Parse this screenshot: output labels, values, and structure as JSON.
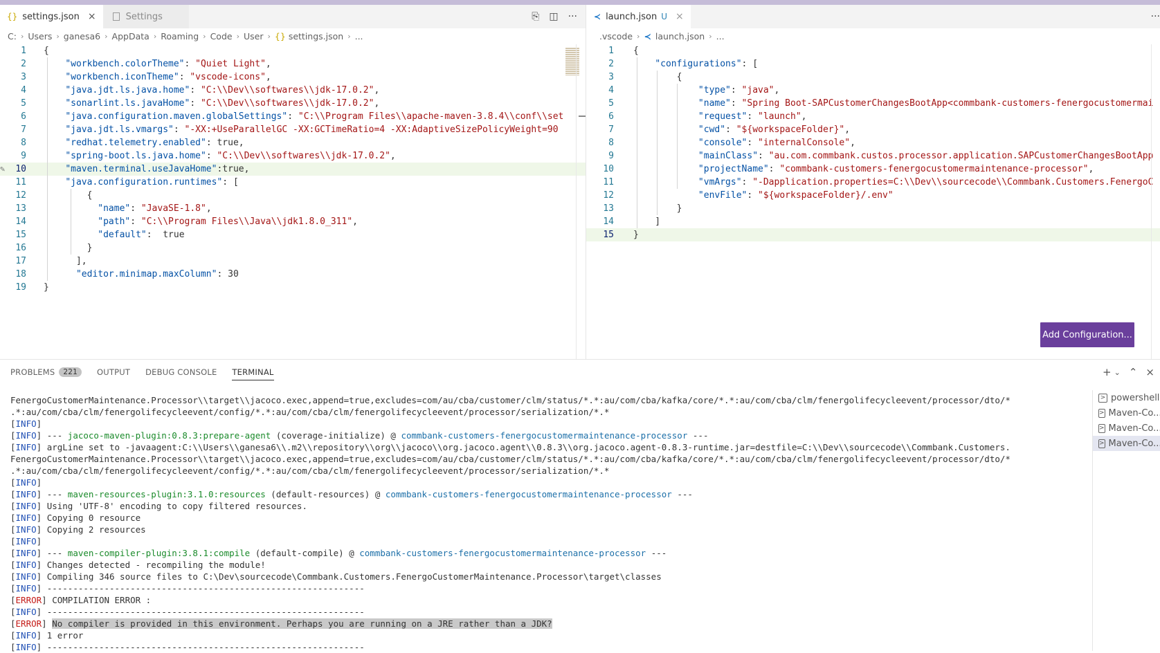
{
  "left_group": {
    "tabs": [
      {
        "icon": "{}",
        "label": "settings.json",
        "close": "×"
      },
      {
        "label": "Settings"
      }
    ],
    "breadcrumb": [
      "C:",
      "Users",
      "ganesa6",
      "AppData",
      "Roaming",
      "Code",
      "User",
      "settings.json",
      "..."
    ],
    "lines": [
      {
        "n": "1",
        "text": "{"
      },
      {
        "n": "2",
        "text": "    \"workbench.colorTheme\": \"Quiet Light\","
      },
      {
        "n": "3",
        "text": "    \"workbench.iconTheme\": \"vscode-icons\","
      },
      {
        "n": "4",
        "text": "    \"java.jdt.ls.java.home\": \"C:\\\\Dev\\\\softwares\\\\jdk-17.0.2\","
      },
      {
        "n": "5",
        "text": "    \"sonarlint.ls.javaHome\": \"C:\\\\Dev\\\\softwares\\\\jdk-17.0.2\","
      },
      {
        "n": "6",
        "text": "    \"java.configuration.maven.globalSettings\": \"C:\\\\Program Files\\\\apache-maven-3.8.4\\\\conf\\\\set"
      },
      {
        "n": "7",
        "text": "    \"java.jdt.ls.vmargs\": \"-XX:+UseParallelGC -XX:GCTimeRatio=4 -XX:AdaptiveSizePolicyWeight=90"
      },
      {
        "n": "8",
        "text": "    \"redhat.telemetry.enabled\": true,"
      },
      {
        "n": "9",
        "text": "    \"spring-boot.ls.java.home\": \"C:\\\\Dev\\\\softwares\\\\jdk-17.0.2\","
      },
      {
        "n": "10",
        "text": "    \"maven.terminal.useJavaHome\":true,"
      },
      {
        "n": "11",
        "text": "    \"java.configuration.runtimes\": ["
      },
      {
        "n": "12",
        "text": "        {"
      },
      {
        "n": "13",
        "text": "          \"name\": \"JavaSE-1.8\","
      },
      {
        "n": "14",
        "text": "          \"path\": \"C:\\\\Program Files\\\\Java\\\\jdk1.8.0_311\","
      },
      {
        "n": "15",
        "text": "          \"default\":  true"
      },
      {
        "n": "16",
        "text": "        }"
      },
      {
        "n": "17",
        "text": "      ],"
      },
      {
        "n": "18",
        "text": "      \"editor.minimap.maxColumn\": 30"
      },
      {
        "n": "19",
        "text": "}"
      }
    ],
    "actions": [
      "⎘",
      "◫",
      "···"
    ]
  },
  "right_group": {
    "tabs": [
      {
        "label": "launch.json",
        "badge": "U",
        "close": "×"
      }
    ],
    "breadcrumb": [
      ".vscode",
      "launch.json",
      "..."
    ],
    "lines": [
      {
        "n": "1",
        "text": "{"
      },
      {
        "n": "2",
        "text": "    \"configurations\": ["
      },
      {
        "n": "3",
        "text": "        {"
      },
      {
        "n": "4",
        "text": "            \"type\": \"java\","
      },
      {
        "n": "5",
        "text": "            \"name\": \"Spring Boot-SAPCustomerChangesBootApp<commbank-customers-fenergocustomermai"
      },
      {
        "n": "6",
        "text": "            \"request\": \"launch\","
      },
      {
        "n": "7",
        "text": "            \"cwd\": \"${workspaceFolder}\","
      },
      {
        "n": "8",
        "text": "            \"console\": \"internalConsole\","
      },
      {
        "n": "9",
        "text": "            \"mainClass\": \"au.com.commbank.custos.processor.application.SAPCustomerChangesBootApp"
      },
      {
        "n": "10",
        "text": "            \"projectName\": \"commbank-customers-fenergocustomermaintenance-processor\","
      },
      {
        "n": "11",
        "text": "            \"vmArgs\": \"-Dapplication.properties=C:\\\\Dev\\\\sourcecode\\\\Commbank.Customers.FenergoC"
      },
      {
        "n": "12",
        "text": "            \"envFile\": \"${workspaceFolder}/.env\""
      },
      {
        "n": "13",
        "text": "        }"
      },
      {
        "n": "14",
        "text": "    ]"
      },
      {
        "n": "15",
        "text": "}"
      }
    ],
    "add_configuration": "Add Configuration...",
    "more": "···"
  },
  "panel": {
    "tabs": [
      {
        "label": "PROBLEMS",
        "badge": "221"
      },
      {
        "label": "OUTPUT"
      },
      {
        "label": "DEBUG CONSOLE"
      },
      {
        "label": "TERMINAL"
      }
    ],
    "actions": [
      "+",
      "⌄",
      "⌃",
      "×"
    ],
    "terminal_lines": [
      [
        {
          "t": "FenergoCustomerMaintenance.Processor\\\\target\\\\jacoco.exec,append=true,excludes=com/au/cba/customer/clm/status/*.*:au/com/cba/kafka/core/*.*:au/com/cba/clm/fenergolifecycleevent/processor/dto/*"
        }
      ],
      [
        {
          "t": ".*:au/com/cba/clm/fenergolifecycleevent/config/*.*:au/com/cba/clm/fenergolifecycleevent/processor/serialization/*.*"
        }
      ],
      [
        {
          "t": "["
        },
        {
          "t": "INFO",
          "c": "info"
        },
        {
          "t": "]"
        }
      ],
      [
        {
          "t": "["
        },
        {
          "t": "INFO",
          "c": "info"
        },
        {
          "t": "] --- "
        },
        {
          "t": "jacoco-maven-plugin:0.8.3:prepare-agent",
          "c": "grn"
        },
        {
          "t": " (coverage-initialize) @ "
        },
        {
          "t": "commbank-customers-fenergocustomermaintenance-processor",
          "c": "cyn"
        },
        {
          "t": " ---"
        }
      ],
      [
        {
          "t": "["
        },
        {
          "t": "INFO",
          "c": "info"
        },
        {
          "t": "] argLine set to -javaagent:C:\\\\Users\\\\ganesa6\\\\.m2\\\\repository\\\\org\\\\jacoco\\\\org.jacoco.agent\\\\0.8.3\\\\org.jacoco.agent-0.8.3-runtime.jar=destfile=C:\\\\Dev\\\\sourcecode\\\\Commbank.Customers."
        }
      ],
      [
        {
          "t": "FenergoCustomerMaintenance.Processor\\\\target\\\\jacoco.exec,append=true,excludes=com/au/cba/customer/clm/status/*.*:au/com/cba/kafka/core/*.*:au/com/cba/clm/fenergolifecycleevent/processor/dto/*"
        }
      ],
      [
        {
          "t": ".*:au/com/cba/clm/fenergolifecycleevent/config/*.*:au/com/cba/clm/fenergolifecycleevent/processor/serialization/*.*"
        }
      ],
      [
        {
          "t": "["
        },
        {
          "t": "INFO",
          "c": "info"
        },
        {
          "t": "]"
        }
      ],
      [
        {
          "t": "["
        },
        {
          "t": "INFO",
          "c": "info"
        },
        {
          "t": "] --- "
        },
        {
          "t": "maven-resources-plugin:3.1.0:resources",
          "c": "grn"
        },
        {
          "t": " (default-resources) @ "
        },
        {
          "t": "commbank-customers-fenergocustomermaintenance-processor",
          "c": "cyn"
        },
        {
          "t": " ---"
        }
      ],
      [
        {
          "t": "["
        },
        {
          "t": "INFO",
          "c": "info"
        },
        {
          "t": "] Using 'UTF-8' encoding to copy filtered resources."
        }
      ],
      [
        {
          "t": "["
        },
        {
          "t": "INFO",
          "c": "info"
        },
        {
          "t": "] Copying 0 resource"
        }
      ],
      [
        {
          "t": "["
        },
        {
          "t": "INFO",
          "c": "info"
        },
        {
          "t": "] Copying 2 resources"
        }
      ],
      [
        {
          "t": "["
        },
        {
          "t": "INFO",
          "c": "info"
        },
        {
          "t": "]"
        }
      ],
      [
        {
          "t": "["
        },
        {
          "t": "INFO",
          "c": "info"
        },
        {
          "t": "] --- "
        },
        {
          "t": "maven-compiler-plugin:3.8.1:compile",
          "c": "grn"
        },
        {
          "t": " (default-compile) @ "
        },
        {
          "t": "commbank-customers-fenergocustomermaintenance-processor",
          "c": "cyn"
        },
        {
          "t": " ---"
        }
      ],
      [
        {
          "t": "["
        },
        {
          "t": "INFO",
          "c": "info"
        },
        {
          "t": "] Changes detected - recompiling the module!"
        }
      ],
      [
        {
          "t": "["
        },
        {
          "t": "INFO",
          "c": "info"
        },
        {
          "t": "] Compiling 346 source files to C:\\Dev\\sourcecode\\Commbank.Customers.FenergoCustomerMaintenance.Processor\\target\\classes"
        }
      ],
      [
        {
          "t": "["
        },
        {
          "t": "INFO",
          "c": "info"
        },
        {
          "t": "] -------------------------------------------------------------"
        }
      ],
      [
        {
          "t": "["
        },
        {
          "t": "ERROR",
          "c": "err"
        },
        {
          "t": "] COMPILATION ERROR :"
        }
      ],
      [
        {
          "t": "["
        },
        {
          "t": "INFO",
          "c": "info"
        },
        {
          "t": "] -------------------------------------------------------------"
        }
      ],
      [
        {
          "t": "["
        },
        {
          "t": "ERROR",
          "c": "err"
        },
        {
          "t": "] "
        },
        {
          "t": "No compiler is provided in this environment. Perhaps you are running on a JRE rather than a JDK?",
          "c": "sel"
        }
      ],
      [
        {
          "t": "["
        },
        {
          "t": "INFO",
          "c": "info"
        },
        {
          "t": "] 1 error"
        }
      ],
      [
        {
          "t": "["
        },
        {
          "t": "INFO",
          "c": "info"
        },
        {
          "t": "] -------------------------------------------------------------"
        }
      ]
    ],
    "terminals": [
      {
        "label": "powershell"
      },
      {
        "label": "Maven-Co..."
      },
      {
        "label": "Maven-Co..."
      },
      {
        "label": "Maven-Co...",
        "selected": true
      }
    ]
  }
}
